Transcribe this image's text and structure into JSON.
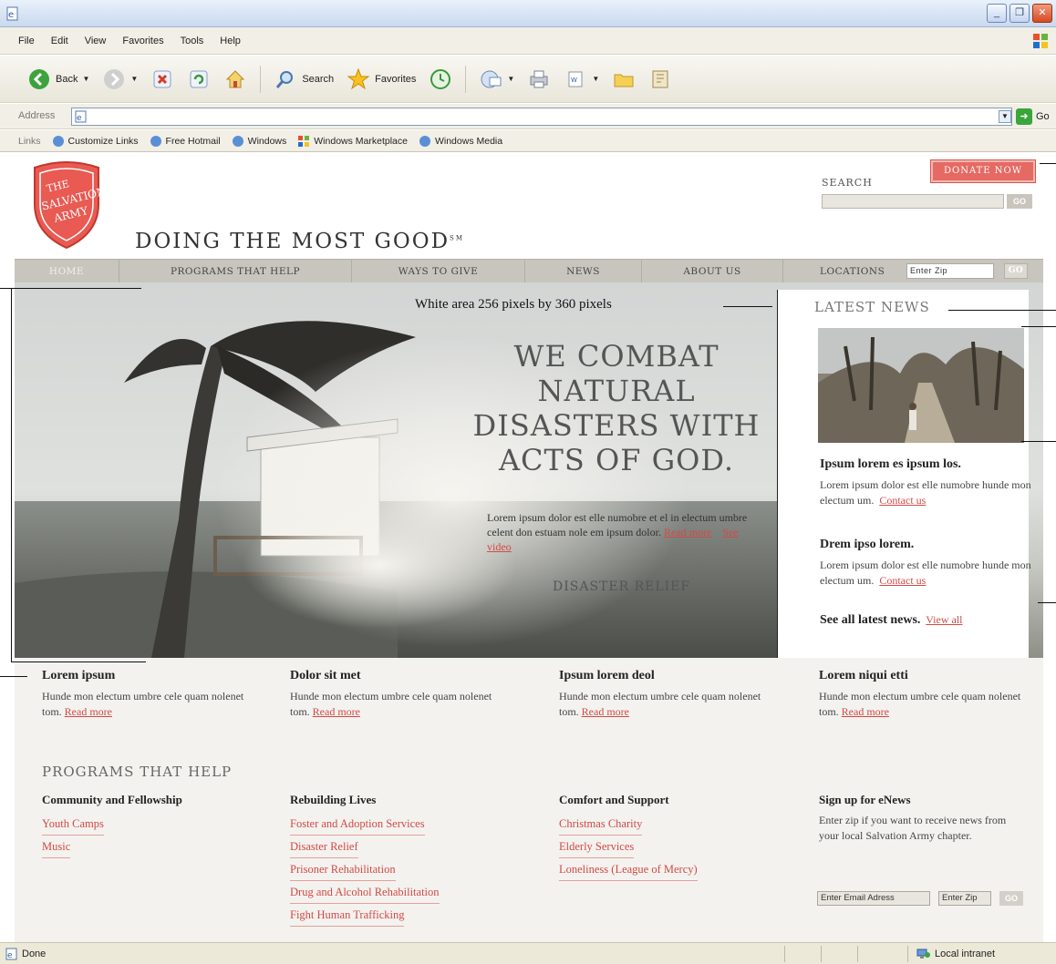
{
  "browser": {
    "menu": [
      "File",
      "Edit",
      "View",
      "Favorites",
      "Tools",
      "Help"
    ],
    "toolbar": {
      "back": "Back",
      "search": "Search",
      "favorites": "Favorites"
    },
    "address_label": "Address",
    "go_label": "Go",
    "links_label": "Links",
    "links": [
      "Customize Links",
      "Free Hotmail",
      "Windows",
      "Windows Marketplace",
      "Windows Media"
    ],
    "status": {
      "done": "Done",
      "zone": "Local intranet"
    }
  },
  "header": {
    "logo_text": "THE SALVATION ARMY",
    "tagline": "Doing the most good",
    "tagline_mark": "SM",
    "search_label": "SEARCH",
    "search_go": "GO",
    "donate": "DONATE NOW"
  },
  "nav": {
    "items": [
      "HOME",
      "PROGRAMS THAT HELP",
      "WAYS TO GIVE",
      "NEWS",
      "ABOUT US"
    ],
    "locations": "LOCATIONS",
    "zip_placeholder": "Enter Zip",
    "zip_go": "GO"
  },
  "hero": {
    "headline": "We combat natural disasters with acts of God.",
    "body": "Lorem ipsum dolor est elle numobre et el in electum umbre celent don estuam nole em ipsum dolor.",
    "read_more": "Read more",
    "see_video": "See video",
    "subtitle": "Disaster Relief"
  },
  "latest_news": {
    "title": "LATEST NEWS",
    "items": [
      {
        "headline": "Ipsum lorem es ipsum los.",
        "body": "Lorem ipsum dolor est elle numobre hunde mon electum um.",
        "link": "Contact us"
      },
      {
        "headline": "Drem ipso lorem.",
        "body": "Lorem ipsum dolor est elle numobre hunde mon electum um.",
        "link": "Contact us"
      }
    ],
    "see_all": "See all latest news.",
    "view_all": "View all"
  },
  "features": [
    {
      "title": "Lorem ipsum",
      "body": "Hunde mon electum umbre cele quam nolenet tom.",
      "link": "Read more"
    },
    {
      "title": "Dolor sit met",
      "body": "Hunde mon electum umbre cele quam nolenet tom.",
      "link": "Read more"
    },
    {
      "title": "Ipsum lorem deol",
      "body": "Hunde mon electum umbre cele quam nolenet tom.",
      "link": "Read more"
    },
    {
      "title": "Lorem niqui etti",
      "body": "Hunde mon electum umbre cele quam nolenet tom.",
      "link": "Read more"
    }
  ],
  "programs": {
    "title": "Programs that help",
    "columns": [
      {
        "heading": "Community and Fellowship",
        "links": [
          "Youth Camps",
          "Music"
        ]
      },
      {
        "heading": "Rebuilding Lives",
        "links": [
          "Foster and Adoption Services",
          "Disaster Relief",
          "Prisoner Rehabilitation",
          "Drug and Alcohol Rehabilitation",
          "Fight Human Trafficking"
        ]
      },
      {
        "heading": "Comfort and Support",
        "links": [
          "Christmas Charity",
          "Elderly Services",
          "Loneliness (League of Mercy)"
        ]
      }
    ],
    "enews": {
      "heading": "Sign up for eNews",
      "body": "Enter zip if you want to receive news from your local Salvation Army chapter.",
      "email_placeholder": "Enter Email Adress",
      "zip_placeholder": "Enter Zip",
      "go": "GO"
    }
  },
  "annotation": "White area 256 pixels by 360 pixels",
  "colors": {
    "accent": "#d24a45",
    "nav": "#c8c5be",
    "donate": "#e56a63"
  }
}
